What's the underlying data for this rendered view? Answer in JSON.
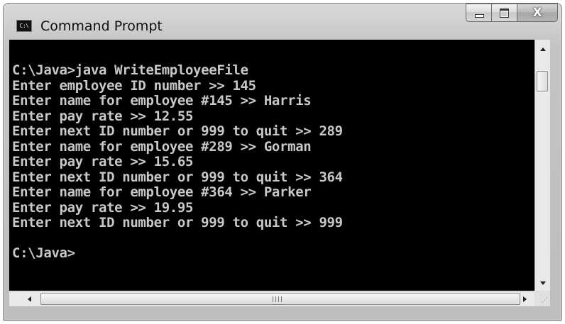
{
  "window": {
    "title": "Command Prompt",
    "app_icon_text": "C:\\",
    "icons": {
      "app": "command-prompt-icon",
      "minimize": "minimize-icon",
      "maximize": "maximize-icon",
      "close": "close-icon",
      "scroll_up": "arrow-up-icon",
      "scroll_down": "arrow-down-icon",
      "scroll_left": "arrow-left-icon",
      "scroll_right": "arrow-right-icon",
      "size_grip": "resize-grip-icon"
    },
    "close_glyph": "X"
  },
  "console": {
    "background": "#000000",
    "foreground": "#c8c8c8",
    "lines": [
      "C:\\Java>java WriteEmployeeFile",
      "Enter employee ID number >> 145",
      "Enter name for employee #145 >> Harris",
      "Enter pay rate >> 12.55",
      "Enter next ID number or 999 to quit >> 289",
      "Enter name for employee #289 >> Gorman",
      "Enter pay rate >> 15.65",
      "Enter next ID number or 999 to quit >> 364",
      "Enter name for employee #364 >> Parker",
      "Enter pay rate >> 19.95",
      "Enter next ID number or 999 to quit >> 999",
      "",
      "C:\\Java>"
    ]
  },
  "scrollbars": {
    "horizontal_grip": "III"
  }
}
